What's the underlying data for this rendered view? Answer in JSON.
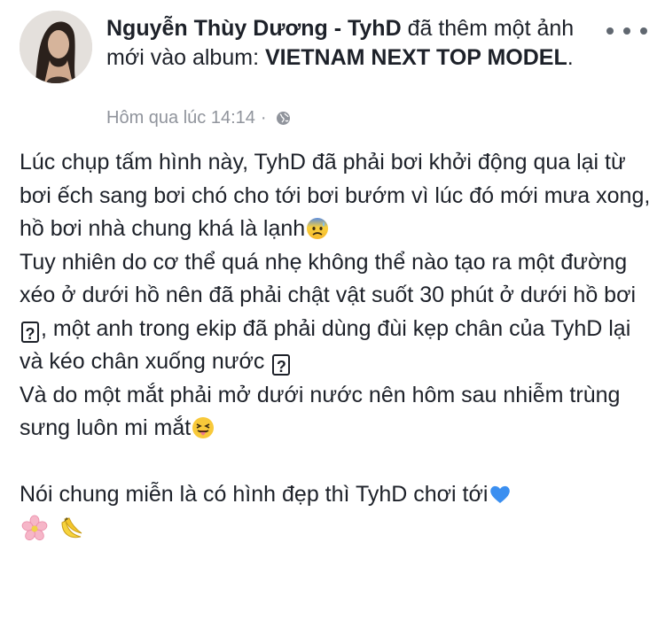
{
  "post": {
    "author": "Nguyễn Thùy Dương - TyhD",
    "action_text": " đã thêm một ảnh mới vào album: ",
    "album": "VIETNAM NEXT TOP MODEL",
    "album_suffix": ".",
    "timestamp": "Hôm qua lúc 14:14",
    "meta_separator": "·",
    "privacy_icon": "globe-icon",
    "more_icon": "more-dots-icon"
  },
  "body": {
    "p1": "Lúc chụp tấm hình này, TyhD đã phải bơi khởi động qua lại từ bơi ếch sang bơi chó cho tới bơi bướm vì lúc đó mới mưa xong, hồ bơi nhà chung khá là lạnh",
    "p2a": "Tuy nhiên do cơ thể quá nhẹ không thể nào tạo ra một đường xéo ở dưới hồ nên đã phải chật vật suốt 30 phút ở dưới hồ bơi",
    "p2b": ", một anh trong ekip đã phải dùng đùi kẹp chân của TyhD lại và kéo chân xuống nước ",
    "box_char": "?",
    "p3": "Và do một mắt phải mở dưới nước nên hôm sau nhiễm trùng sưng luôn mi mắt",
    "p4": "Nói chung miễn là có hình đẹp thì TyhD chơi tới"
  },
  "icons": {
    "emoji_cold_sweat": "anxious-face-emoji",
    "emoji_tongue": "squinting-tongue-emoji",
    "emoji_heart": "blue-heart-emoji",
    "emoji_flower": "cherry-blossom-emoji",
    "emoji_banana": "banana-emoji"
  },
  "colors": {
    "text": "#1d2129",
    "meta": "#90949c",
    "heart": "#3b8ff0"
  }
}
